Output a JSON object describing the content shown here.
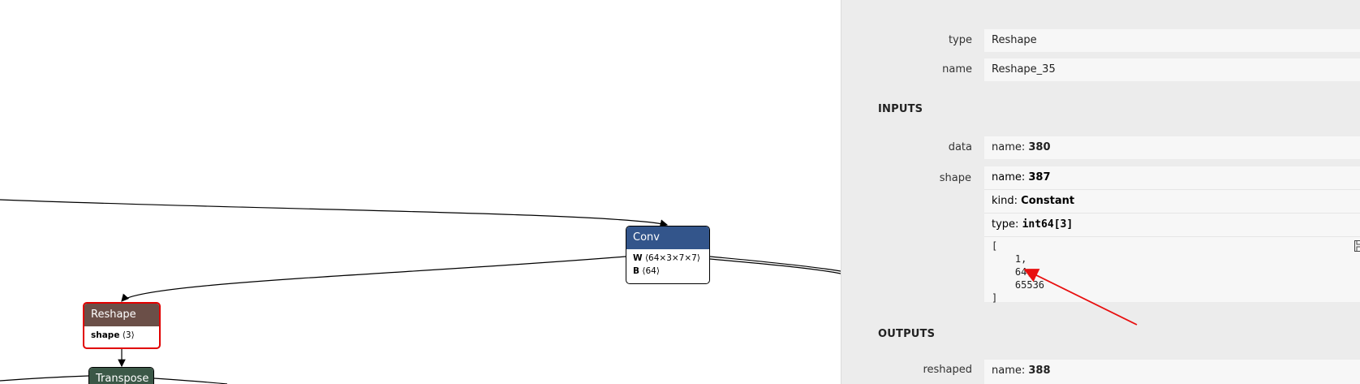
{
  "graph": {
    "conv": {
      "title": "Conv",
      "attrs": [
        {
          "name": "W",
          "shape": "⟨64×3×7×7⟩"
        },
        {
          "name": "B",
          "shape": "⟨64⟩"
        }
      ]
    },
    "reshape": {
      "title": "Reshape",
      "attrs": [
        {
          "name": "shape",
          "shape": "⟨3⟩"
        }
      ]
    },
    "transpose": {
      "title": "Transpose"
    }
  },
  "sidebar": {
    "type_label": "type",
    "type_value": "Reshape",
    "help": "?",
    "name_label": "name",
    "name_value": "Reshape_35",
    "inputs_title": "INPUTS",
    "data_label": "data",
    "data_name_key": "name: ",
    "data_name_val": "380",
    "shape_label": "shape",
    "shape_name_key": "name: ",
    "shape_name_val": "387",
    "collapse": "–",
    "shape_kind_key": "kind: ",
    "shape_kind_val": "Constant",
    "shape_type_key": "type: ",
    "shape_type_val": "int64[3]",
    "shape_tensor": "[\n    1,\n    64,\n    65536\n]",
    "outputs_title": "OUTPUTS",
    "reshaped_label": "reshaped",
    "reshaped_name_key": "name: ",
    "reshaped_name_val": "388"
  },
  "annotation": {
    "arrow_color": "#e81010"
  }
}
